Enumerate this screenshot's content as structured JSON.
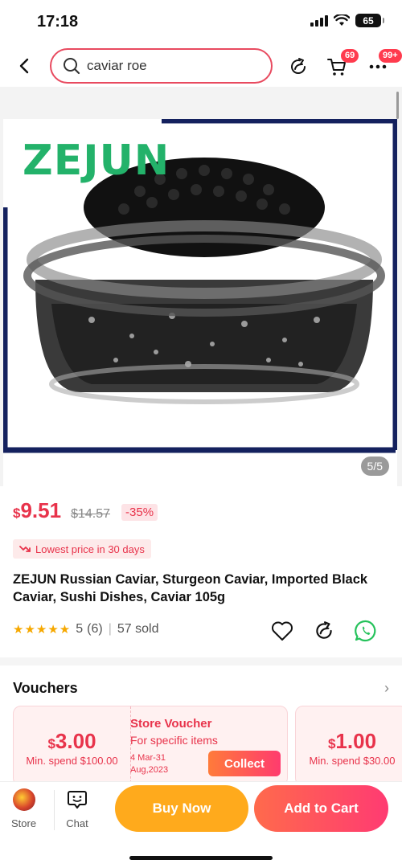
{
  "status_bar": {
    "time": "17:18",
    "battery": "65"
  },
  "header": {
    "search_value": "caviar roe",
    "cart_badge": "69",
    "more_badge": "99+"
  },
  "gallery": {
    "brand_logo": "ZEJUN",
    "counter": "5/5"
  },
  "product": {
    "currency": "$",
    "price": "9.51",
    "original_price": "$14.57",
    "discount": "-35%",
    "lowest_tag": "Lowest price in 30 days",
    "title": "ZEJUN Russian Caviar, Sturgeon Caviar, Imported Black Caviar, Sushi Dishes, Caviar 105g",
    "stars": "★★★★★",
    "rating_value": "5",
    "rating_count": "(6)",
    "sold": "57 sold"
  },
  "vouchers": {
    "heading": "Vouchers",
    "arrow": "›",
    "items": [
      {
        "currency": "$",
        "amount": "3.00",
        "min_spend": "Min. spend $100.00",
        "label": "Store Voucher",
        "scope": "For specific items",
        "dates": "4 Mar-31 Aug,2023",
        "collect_label": "Collect"
      },
      {
        "currency": "$",
        "amount": "1.00",
        "min_spend": "Min. spend $30.00"
      }
    ]
  },
  "bottom_bar": {
    "store_label": "Store",
    "chat_label": "Chat",
    "buy_now_label": "Buy Now",
    "add_to_cart_label": "Add to Cart"
  },
  "colors": {
    "accent": "#e8334b",
    "buy_now": "#ffaa1c",
    "add_to_cart": "#ff3b72",
    "brand_green": "#23b26a",
    "frame_navy": "#14215e"
  }
}
